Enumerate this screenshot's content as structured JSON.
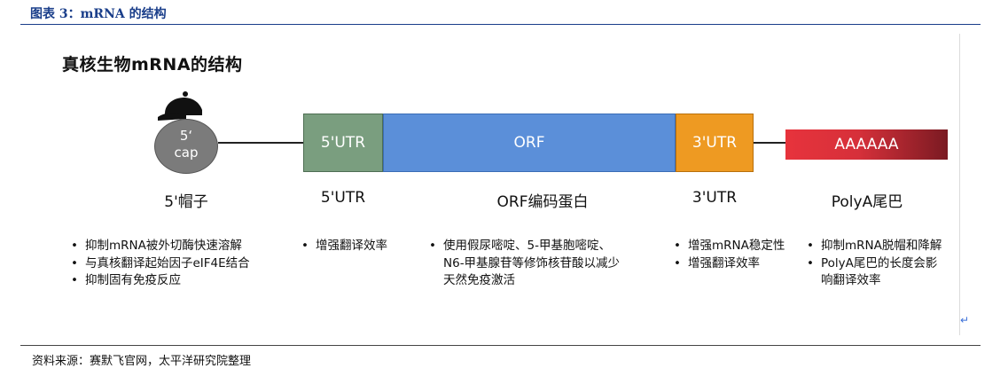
{
  "figure_title": "图表 3：mRNA 的结构",
  "source_note": "资料来源：赛默飞官网，太平洋研究院整理",
  "diagram_title": "真核生物mRNA的结构",
  "cap": {
    "text_line1": "5‘",
    "text_line2": "cap",
    "icon": "baseball-cap-icon"
  },
  "segments": {
    "utr5": "5'UTR",
    "orf": "ORF",
    "utr3": "3'UTR",
    "polya": "AAAAAA"
  },
  "labels": {
    "cap": "5'帽子",
    "utr5": "5'UTR",
    "orf": "ORF编码蛋白",
    "utr3": "3'UTR",
    "polya": "PolyA尾巴"
  },
  "bullets": {
    "cap": [
      "抑制mRNA被外切酶快速溶解",
      "与真核翻译起始因子eIF4E结合",
      "抑制固有免疫反应"
    ],
    "utr5": [
      "增强翻译效率"
    ],
    "orf": [
      "使用假尿嘧啶、5-甲基胞嘧啶、",
      "N6-甲基腺苷等修饰核苷酸以减少",
      "天然免疫激活"
    ],
    "utr3": [
      "增强mRNA稳定性",
      "增强翻译效率"
    ],
    "polya": [
      "抑制mRNA脱帽和降解",
      "PolyA尾巴的长度会影",
      "响翻译效率"
    ]
  },
  "colors": {
    "cap": "#7b7b7b",
    "utr5": "#7a9e7f",
    "orf": "#5b8fd9",
    "utr3": "#ee9a22",
    "polya": "#d6303a",
    "title": "#1a3e8a"
  }
}
